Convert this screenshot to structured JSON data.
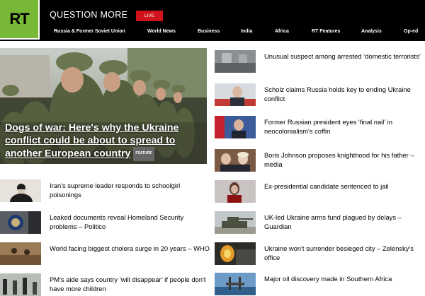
{
  "header": {
    "logo": "RT",
    "tagline": "QUESTION MORE",
    "live_label": "LIVE"
  },
  "nav": [
    "Russia & Former Soviet Union",
    "World News",
    "Business",
    "India",
    "Africa",
    "RT Features",
    "Analysis",
    "Op-ed"
  ],
  "hero": {
    "title": "Dogs of war: Here's why the Ukraine conflict could be about to spread to another European country",
    "badge": "FEATURE"
  },
  "left_list": [
    {
      "title": "Iran's supreme leader responds to schoolgirl poisonings",
      "icon": "cleric-photo"
    },
    {
      "title": "Leaked documents reveal Homeland Security problems – Politico",
      "icon": "dhs-seal-photo"
    },
    {
      "title": "World facing biggest cholera surge in 20 years – WHO",
      "icon": "flood-photo"
    },
    {
      "title": "PM's aide says country ‘will disappear’ if people don't have more children",
      "icon": "crowd-photo"
    }
  ],
  "right_list": [
    {
      "title": "Unusual suspect among arrested ‘domestic terrorists’",
      "icon": "street-photo"
    },
    {
      "title": "Scholz claims Russia holds key to ending Ukraine conflict",
      "icon": "scholz-photo"
    },
    {
      "title": "Former Russian president eyes ‘final nail’ in neocolonialism's coffin",
      "icon": "medvedev-photo"
    },
    {
      "title": "Boris Johnson proposes knighthood for his father – media",
      "icon": "johnson-photo"
    },
    {
      "title": "Ex-presidential candidate sentenced to jail",
      "icon": "candidate-photo"
    },
    {
      "title": "UK-led Ukraine arms fund plagued by delays – Guardian",
      "icon": "tank-photo"
    },
    {
      "title": "Ukraine won't surrender besieged city – Zelensky's office",
      "icon": "explosion-photo"
    },
    {
      "title": "Major oil discovery made in Southern Africa",
      "icon": "oil-rig-photo"
    }
  ],
  "colors": {
    "header_bg": "#000000",
    "logo_green": "#77b837",
    "live_red": "#d0121b"
  }
}
